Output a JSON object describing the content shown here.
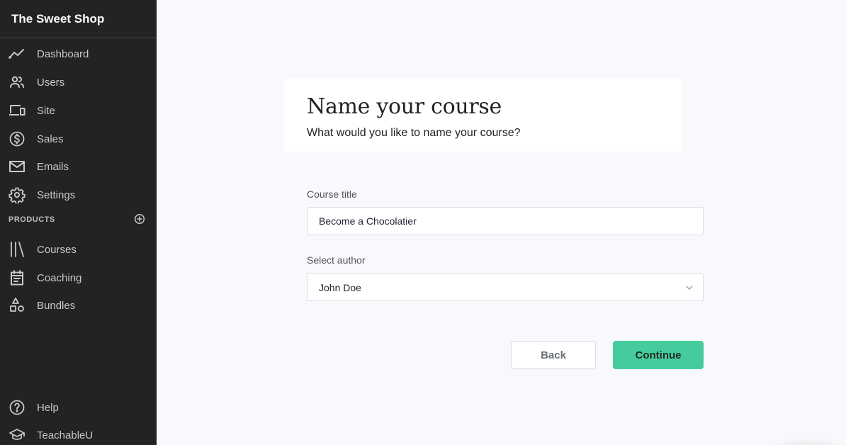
{
  "sidebar": {
    "brand": "The Sweet Shop",
    "items": [
      {
        "label": "Dashboard",
        "icon": "chart-line-icon"
      },
      {
        "label": "Users",
        "icon": "users-icon"
      },
      {
        "label": "Site",
        "icon": "devices-icon"
      },
      {
        "label": "Sales",
        "icon": "dollar-circle-icon"
      },
      {
        "label": "Emails",
        "icon": "mail-icon"
      },
      {
        "label": "Settings",
        "icon": "gear-icon"
      }
    ],
    "products_header": "PRODUCTS",
    "product_items": [
      {
        "label": "Courses",
        "icon": "library-icon"
      },
      {
        "label": "Coaching",
        "icon": "calendar-icon"
      },
      {
        "label": "Bundles",
        "icon": "shapes-icon"
      }
    ],
    "footer_items": [
      {
        "label": "Help",
        "icon": "question-circle-icon"
      },
      {
        "label": "TeachableU",
        "icon": "graduation-cap-icon"
      }
    ]
  },
  "main": {
    "title": "Name your course",
    "subtitle": "What would you like to name your course?",
    "course_title_label": "Course title",
    "course_title_value": "Become a Chocolatier",
    "author_label": "Select author",
    "author_value": "John Doe",
    "back_label": "Back",
    "continue_label": "Continue"
  },
  "colors": {
    "sidebar_bg": "#232323",
    "page_bg": "#f8f9fc",
    "accent": "#46cc9c"
  }
}
